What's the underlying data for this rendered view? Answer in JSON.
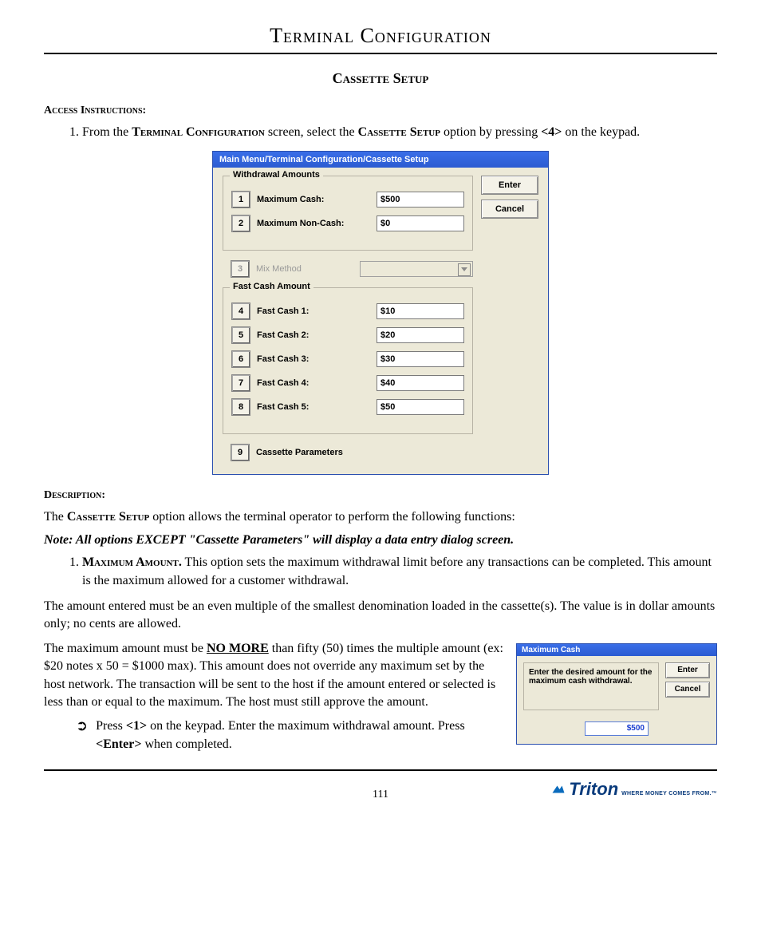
{
  "header": {
    "title": "Terminal Configuration"
  },
  "subtitle": "Cassette Setup",
  "access": {
    "label": "Access Instructions:",
    "item1_pre": "From the ",
    "item1_sc1": "Terminal Configuration",
    "item1_mid": " screen, select the ",
    "item1_sc2": "Cassette Setup",
    "item1_post": " option by pressing ",
    "item1_key": "<4>",
    "item1_end": " on the keypad."
  },
  "dialog": {
    "title": "Main Menu/Terminal Configuration/Cassette Setup",
    "group_withdrawal": "Withdrawal Amounts",
    "group_fastcash": "Fast Cash Amount",
    "rows": {
      "r1": {
        "key": "1",
        "label": "Maximum Cash:",
        "value": "$500"
      },
      "r2": {
        "key": "2",
        "label": "Maximum Non-Cash:",
        "value": "$0"
      },
      "r3": {
        "key": "3",
        "label": "Mix Method"
      },
      "r4": {
        "key": "4",
        "label": "Fast Cash 1:",
        "value": "$10"
      },
      "r5": {
        "key": "5",
        "label": "Fast Cash 2:",
        "value": "$20"
      },
      "r6": {
        "key": "6",
        "label": "Fast Cash 3:",
        "value": "$30"
      },
      "r7": {
        "key": "7",
        "label": "Fast Cash 4:",
        "value": "$40"
      },
      "r8": {
        "key": "8",
        "label": "Fast Cash 5:",
        "value": "$50"
      },
      "r9": {
        "key": "9",
        "label": "Cassette Parameters"
      }
    },
    "side": {
      "enter": "Enter",
      "cancel": "Cancel"
    }
  },
  "description": {
    "label": "Description:",
    "line1_pre": "The ",
    "line1_sc": "Cassette Setup",
    "line1_post": " option allows the terminal operator to perform the following functions:",
    "note": "Note:  All options EXCEPT \"Cassette Parameters\" will display a data entry dialog screen.",
    "item1_sc": "Maximum Amount.",
    "item1_body": "   This option sets the maximum withdrawal limit before any transactions can be completed.  This amount is the maximum allowed for a customer withdrawal.",
    "para2": "The amount entered must be an even multiple of the smallest denomination loaded in the cassette(s). The value is in dollar amounts only; no cents are allowed.",
    "para3_pre": "The maximum amount must be ",
    "para3_u": "NO MORE",
    "para3_post": " than fifty (50) times the multiple amount (ex: $20 notes x 50 = $1000 max).  This amount does not override any maximum set by the host network.  The transaction will be sent to the host if the amount entered or selected is less than or equal to the maximum. The host must still approve the amount.",
    "bullet_pre": "Press ",
    "bullet_k1": "<1>",
    "bullet_mid": " on the keypad.  Enter the maximum withdrawal amount. Press ",
    "bullet_k2": "<Enter>",
    "bullet_end": " when completed."
  },
  "mini": {
    "title": "Maximum Cash",
    "prompt": "Enter the desired amount for the maximum cash withdrawal.",
    "value": "$500",
    "enter": "Enter",
    "cancel": "Cancel"
  },
  "footer": {
    "page": "111",
    "brand": "Triton",
    "tag": "WHERE MONEY COMES FROM.™"
  }
}
